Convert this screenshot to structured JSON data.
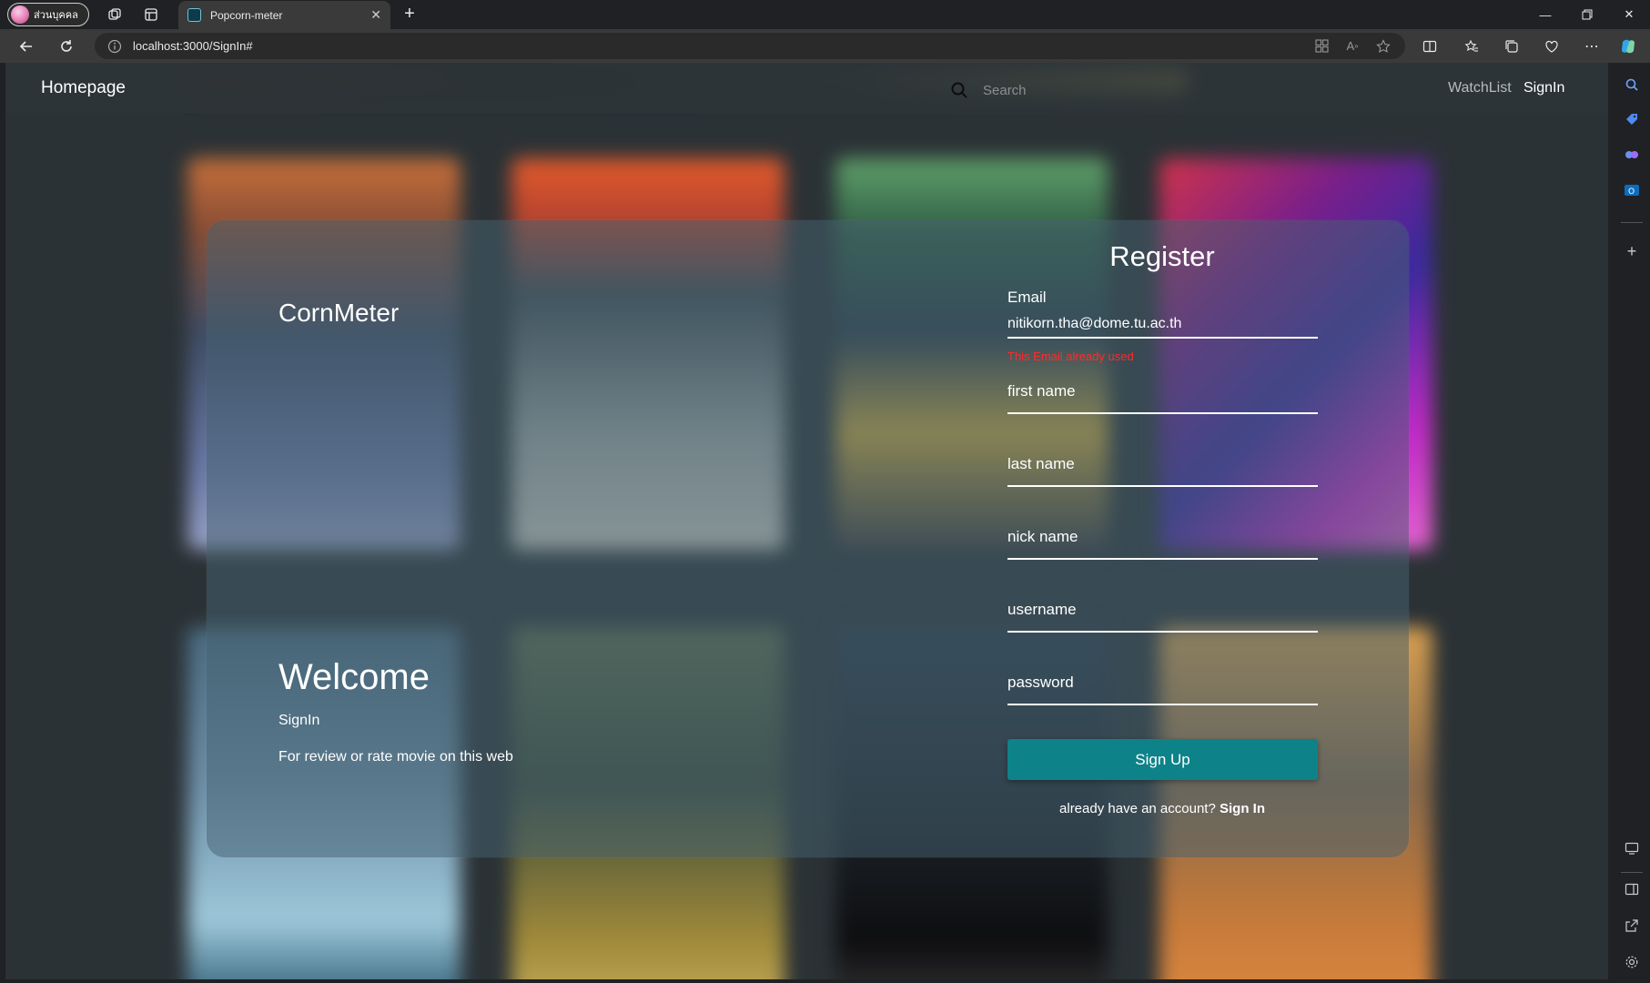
{
  "browser": {
    "profile_label": "ส่วนบุคคล",
    "tab_title": "Popcorn-meter",
    "url": "localhost:3000/SignIn#",
    "icons": [
      "workspaces-icon",
      "tab-actions-icon",
      "back-icon",
      "reload-icon",
      "info-icon",
      "app-available-icon",
      "read-aloud-icon",
      "favorite-star-icon",
      "split-screen-icon",
      "favorites-icon",
      "collections-icon",
      "browser-essentials-icon",
      "more-icon",
      "copilot-icon"
    ],
    "sidebar_icons": [
      "search-icon",
      "shopping-tag-icon",
      "games-icon",
      "outlook-icon",
      "add-icon",
      "screenshot-icon",
      "split-view-icon",
      "open-external-icon",
      "settings-icon"
    ]
  },
  "site": {
    "brand": "Homepage",
    "search_placeholder": "Search",
    "nav": {
      "watchlist": "WatchList",
      "signin": "SignIn"
    }
  },
  "card": {
    "logo": "CornMeter",
    "welcome_title": "Welcome",
    "welcome_sub": "SignIn",
    "welcome_desc": "For review or rate movie on this web"
  },
  "register": {
    "title": "Register",
    "email_label": "Email",
    "email_value": "nitikorn.tha@dome.tu.ac.th",
    "email_error": "This Email already used",
    "first_name": "first name",
    "last_name": "last name",
    "nick_name": "nick name",
    "username": "username",
    "password": "password",
    "submit": "Sign Up",
    "already_text": "already have an account?",
    "signin_link": "Sign In"
  },
  "colors": {
    "accent": "#0e8289",
    "error": "#ff2b2b",
    "page_bg": "#2b3236"
  }
}
